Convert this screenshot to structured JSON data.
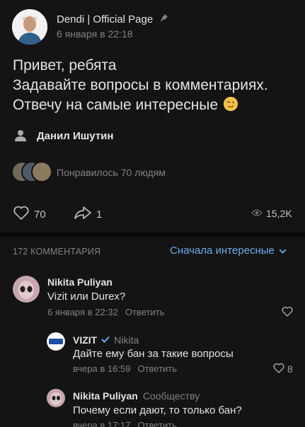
{
  "post": {
    "author": "Dendi | Official Page",
    "date": "6 января в 22:18",
    "text_lines": [
      "Привет, ребята",
      "Задавайте вопросы в комментариях.",
      "Отвечу на самые интересные"
    ],
    "signer": "Данил Ишутин",
    "likes_text": "Понравилось 70 людям",
    "like_count": "70",
    "share_count": "1",
    "views": "15,2K",
    "icons": {
      "pin": "pin-icon",
      "signer": "person-icon",
      "like": "heart-icon",
      "share": "share-arrow-icon",
      "views": "eye-icon"
    }
  },
  "comments": {
    "count_label": "172 КОММЕНТАРИЯ",
    "sort_label": "Сначала интересные",
    "items": [
      {
        "name": "Nikita Puliyan",
        "text": "Vizit или Durex?",
        "date": "6 января в 22:32",
        "reply_label": "Ответить"
      },
      {
        "name": "VIZIT",
        "reply_to": "Nikita",
        "text": "Дайте ему бан за такие вопросы",
        "date": "вчера в 16:59",
        "reply_label": "Ответить",
        "likes": "8",
        "logo_text": "VIZIT"
      },
      {
        "name": "Nikita Puliyan",
        "reply_to": "Сообществу",
        "text": "Почему если дают, то только бан?",
        "date": "вчера в 17:17",
        "reply_label": "Ответить"
      }
    ]
  },
  "colors": {
    "background": "#141414",
    "accent": "#71aaeb",
    "text": "#e1e3e6",
    "muted": "#828282"
  }
}
